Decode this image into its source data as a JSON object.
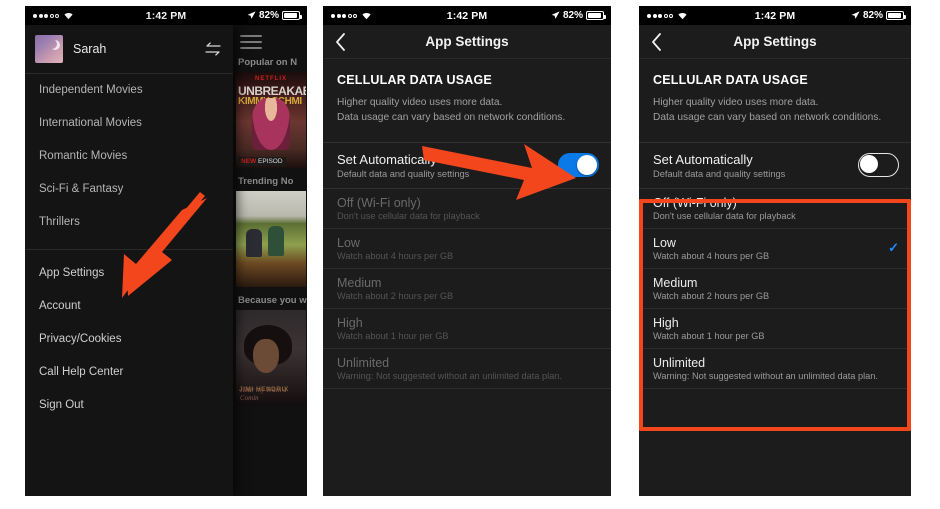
{
  "status_bar": {
    "signal_dots_filled": 3,
    "signal_dots_total": 5,
    "wifi_icon": "wifi-icon",
    "time": "1:42 PM",
    "location_icon": "location-arrow-icon",
    "battery_percent": "82%",
    "battery_level": 82
  },
  "panel1": {
    "name": "netflix-menu-panel",
    "menu": {
      "profile": {
        "avatar_icon": "moon-avatar",
        "name": "Sarah",
        "switch_profile_icon": "switch-profile-icon"
      },
      "categories": [
        {
          "label": "Independent Movies"
        },
        {
          "label": "International Movies"
        },
        {
          "label": "Romantic Movies"
        },
        {
          "label": "Sci-Fi & Fantasy"
        },
        {
          "label": "Thrillers"
        }
      ],
      "actions": [
        {
          "label": "App Settings"
        },
        {
          "label": "Account"
        },
        {
          "label": "Privacy/Cookies"
        },
        {
          "label": "Call Help Center"
        },
        {
          "label": "Sign Out"
        }
      ]
    },
    "browse": {
      "menu_icon": "hamburger-icon",
      "rows": [
        {
          "title": "Popular on N",
          "tile_badge_new": "NEW",
          "tile_badge_text": "EPISOD",
          "tile_brand": "NETFLIX",
          "tile_title_1": "UNBREAKAB",
          "tile_title_2": "KIMMY SCHMI"
        },
        {
          "title": "Trending No"
        },
        {
          "title": "Because you w",
          "tile_caption": "JIMI HENDRIX",
          "tile_signature": "Hear my Train a Comin"
        }
      ]
    },
    "annotation": {
      "arrow_icon": "red-arrow-down-left",
      "arrow_color": "#f4461d",
      "points_to": "App Settings"
    }
  },
  "panel2": {
    "name": "app-settings-toggle-on",
    "nav": {
      "back_icon": "chevron-left-icon",
      "title": "App Settings"
    },
    "section": {
      "heading": "CELLULAR DATA USAGE",
      "description_line1": "Higher quality video uses more data.",
      "description_line2": "Data usage can vary based on network conditions."
    },
    "set_automatically": {
      "title": "Set Automatically",
      "subtitle": "Default data and quality settings",
      "toggle_state": "on",
      "toggle_color": "#0a7ae8"
    },
    "options_disabled": true,
    "options": [
      {
        "title": "Off (Wi-Fi only)",
        "subtitle": "Don't use cellular data for playback",
        "selected": false
      },
      {
        "title": "Low",
        "subtitle": "Watch about 4 hours per GB",
        "selected": false
      },
      {
        "title": "Medium",
        "subtitle": "Watch about 2 hours per GB",
        "selected": false
      },
      {
        "title": "High",
        "subtitle": "Watch about 1 hour per GB",
        "selected": false
      },
      {
        "title": "Unlimited",
        "subtitle": "Warning: Not suggested without an unlimited data plan.",
        "selected": false
      }
    ],
    "annotation": {
      "arrow_icon": "red-arrow-right",
      "arrow_color": "#f4461d",
      "points_to": "Set Automatically toggle"
    }
  },
  "panel3": {
    "name": "app-settings-toggle-off",
    "nav": {
      "back_icon": "chevron-left-icon",
      "title": "App Settings"
    },
    "section": {
      "heading": "CELLULAR DATA USAGE",
      "description_line1": "Higher quality video uses more data.",
      "description_line2": "Data usage can vary based on network conditions."
    },
    "set_automatically": {
      "title": "Set Automatically",
      "subtitle": "Default data and quality settings",
      "toggle_state": "off",
      "toggle_color": "#1c1c1c"
    },
    "options_disabled": false,
    "options": [
      {
        "title": "Off (Wi-Fi only)",
        "subtitle": "Don't use cellular data for playback",
        "selected": false,
        "check": ""
      },
      {
        "title": "Low",
        "subtitle": "Watch about 4 hours per GB",
        "selected": true,
        "check": "✓"
      },
      {
        "title": "Medium",
        "subtitle": "Watch about 2 hours per GB",
        "selected": false,
        "check": ""
      },
      {
        "title": "High",
        "subtitle": "Watch about 1 hour per GB",
        "selected": false,
        "check": ""
      },
      {
        "title": "Unlimited",
        "subtitle": "Warning: Not suggested without an unlimited data plan.",
        "selected": false,
        "check": ""
      }
    ],
    "annotation": {
      "highlight_icon": "red-highlight-box",
      "highlight_color": "#f4461d",
      "surrounds": "quality options list",
      "checkmark_color": "#1a8cff"
    }
  }
}
